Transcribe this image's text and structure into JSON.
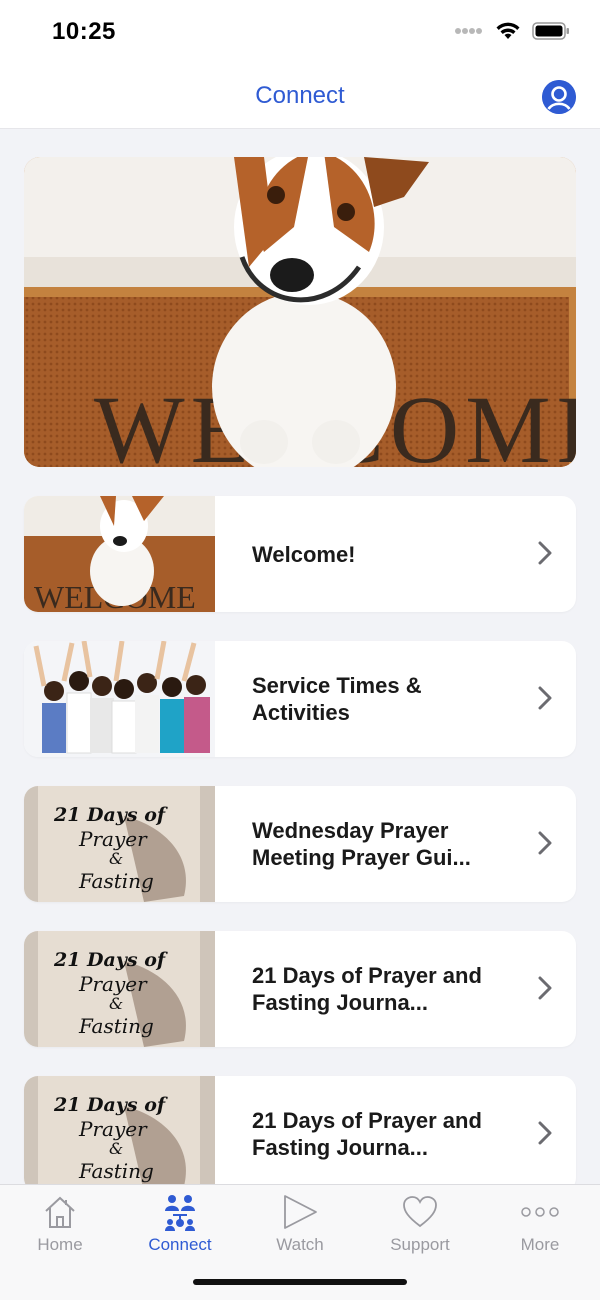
{
  "status": {
    "time": "10:25"
  },
  "nav": {
    "title": "Connect"
  },
  "hero": {
    "mat_text": "WELCOME"
  },
  "rows": [
    {
      "label": "Welcome!",
      "thumb": "dog-welcome"
    },
    {
      "label": "Service Times & Activities",
      "thumb": "group-people"
    },
    {
      "label": "Wednesday Prayer Meeting Prayer Gui...",
      "thumb": "prayer-fasting"
    },
    {
      "label": "21 Days of Prayer and Fasting Journa...",
      "thumb": "prayer-fasting"
    },
    {
      "label": "21 Days of Prayer and Fasting Journa...",
      "thumb": "prayer-fasting"
    }
  ],
  "thumb_text": {
    "line1": "21 Days of",
    "line2": "Prayer",
    "line3": "&",
    "line4": "Fasting"
  },
  "tabs": [
    {
      "label": "Home",
      "icon": "house-icon"
    },
    {
      "label": "Connect",
      "icon": "people-icon",
      "active": true
    },
    {
      "label": "Watch",
      "icon": "play-icon"
    },
    {
      "label": "Support",
      "icon": "heart-icon"
    },
    {
      "label": "More",
      "icon": "ellipsis-icon"
    }
  ],
  "colors": {
    "accent": "#2f5bd3",
    "inactive": "#9a9aa0",
    "background": "#f2f3f7"
  }
}
